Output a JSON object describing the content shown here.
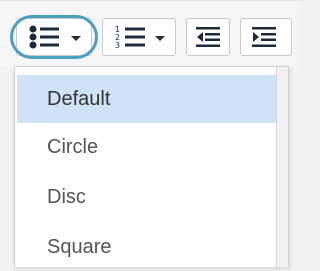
{
  "toolbar": {
    "buttons": [
      {
        "name": "bullet-list-button",
        "icon": "bullet-list-icon",
        "has_dropdown": true
      },
      {
        "name": "numbered-list-button",
        "icon": "numbered-list-icon",
        "has_dropdown": true
      },
      {
        "name": "decrease-indent-button",
        "icon": "outdent-icon"
      },
      {
        "name": "increase-indent-button",
        "icon": "indent-icon"
      }
    ],
    "accent_color": "#4aa0c0"
  },
  "dropdown": {
    "items": [
      {
        "label": "Default",
        "selected": true
      },
      {
        "label": "Circle",
        "selected": false
      },
      {
        "label": "Disc",
        "selected": false
      },
      {
        "label": "Square",
        "selected": false
      }
    ],
    "selected_color": "#cfe2f6"
  }
}
